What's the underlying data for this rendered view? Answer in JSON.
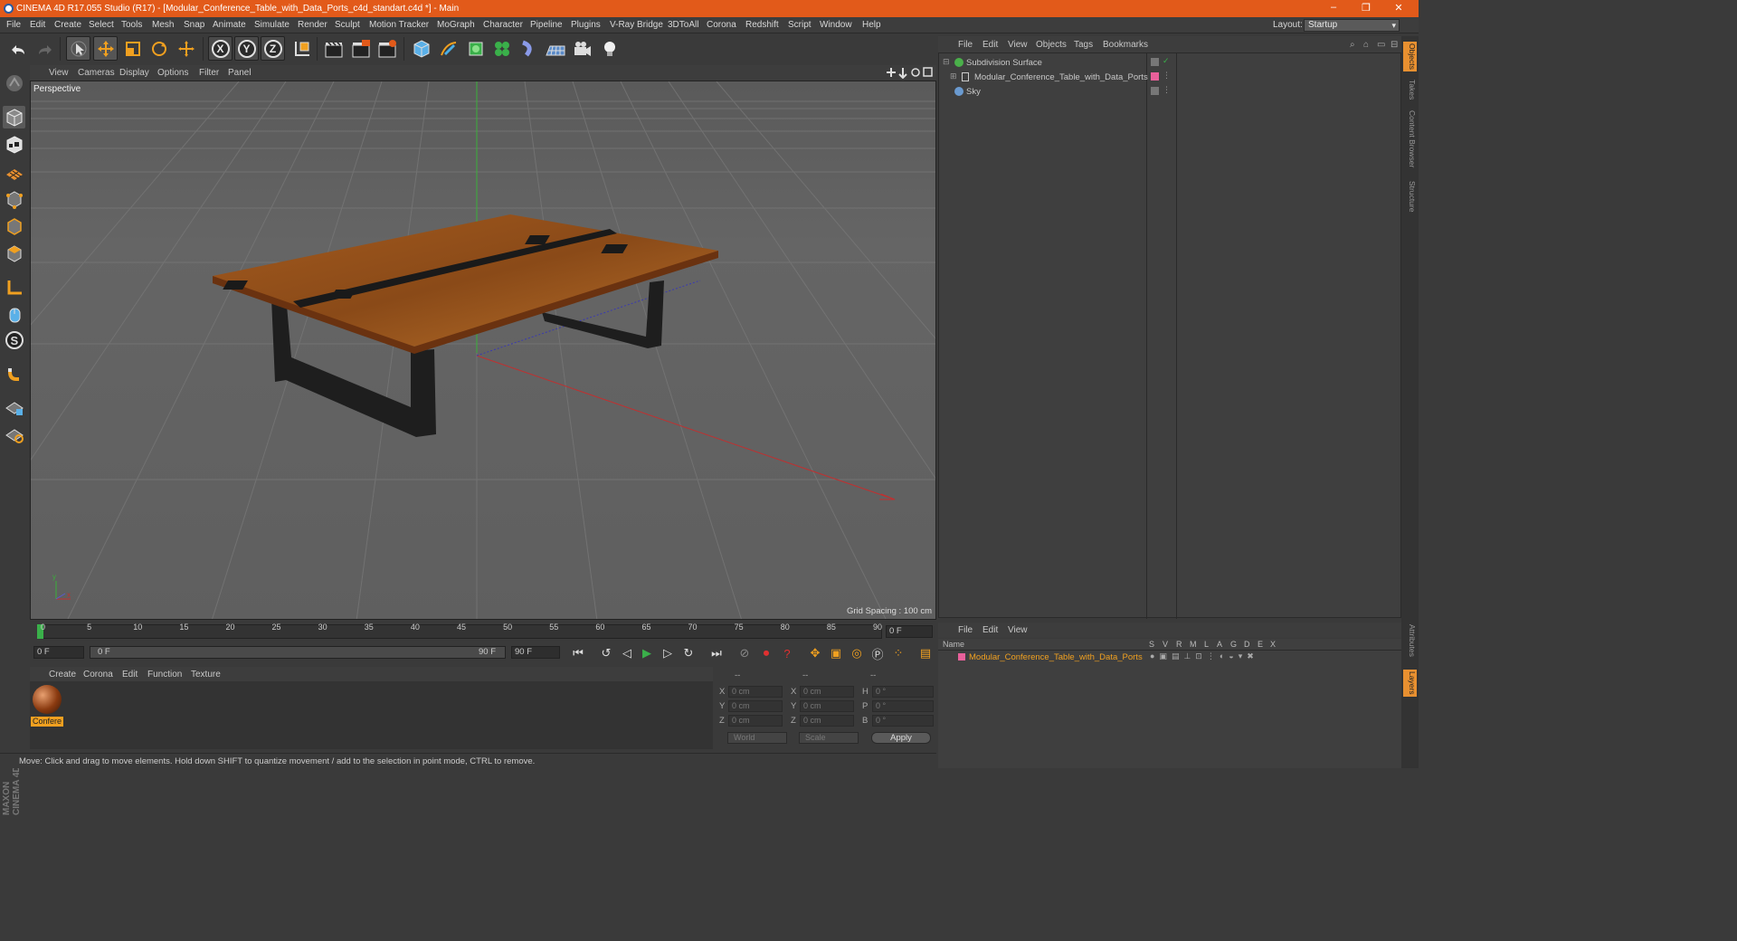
{
  "window": {
    "title": "CINEMA 4D R17.055 Studio (R17) - [Modular_Conference_Table_with_Data_Ports_c4d_standart.c4d *] - Main",
    "minimize": "–",
    "maximize": "❐",
    "close": "✕"
  },
  "menubar": {
    "items": [
      "File",
      "Edit",
      "Create",
      "Select",
      "Tools",
      "Mesh",
      "Snap",
      "Animate",
      "Simulate",
      "Render",
      "Sculpt",
      "Motion Tracker",
      "MoGraph",
      "Character",
      "Pipeline",
      "Plugins",
      "V-Ray Bridge",
      "3DToAll",
      "Corona",
      "Redshift",
      "Script",
      "Window",
      "Help"
    ],
    "layout_label": "Layout:",
    "layout_value": "Startup"
  },
  "toolbar": {
    "axis_x": "X",
    "axis_y": "Y",
    "axis_z": "Z"
  },
  "viewport": {
    "menu": [
      "View",
      "Cameras",
      "Display",
      "Options",
      "Filter",
      "Panel"
    ],
    "label": "Perspective",
    "grid_spacing": "Grid Spacing : 100 cm",
    "axis_y": "y",
    "axis_x": "x"
  },
  "timeline": {
    "ticks": [
      "0",
      "5",
      "10",
      "15",
      "20",
      "25",
      "30",
      "35",
      "40",
      "45",
      "50",
      "55",
      "60",
      "65",
      "70",
      "75",
      "80",
      "85",
      "90"
    ],
    "current_frame": "0 F",
    "start_field": "0 F",
    "range_start": "0 F",
    "range_end": "90 F",
    "end_field": "90 F"
  },
  "material_manager": {
    "menu": [
      "Create",
      "Corona",
      "Edit",
      "Function",
      "Texture"
    ],
    "material_name": "Confere"
  },
  "coordinates": {
    "header": [
      "--",
      "--",
      "--"
    ],
    "rows": [
      {
        "l1": "X",
        "v1": "0 cm",
        "l2": "X",
        "v2": "0 cm",
        "l3": "H",
        "v3": "0 °"
      },
      {
        "l1": "Y",
        "v1": "0 cm",
        "l2": "Y",
        "v2": "0 cm",
        "l3": "P",
        "v3": "0 °"
      },
      {
        "l1": "Z",
        "v1": "0 cm",
        "l2": "Z",
        "v2": "0 cm",
        "l3": "B",
        "v3": "0 °"
      }
    ],
    "mode": "World",
    "transform": "Scale",
    "apply": "Apply"
  },
  "status": {
    "text": "Move: Click and drag to move elements. Hold down SHIFT to quantize movement / add to the selection in point mode, CTRL to remove."
  },
  "object_manager": {
    "menu": [
      "File",
      "Edit",
      "View",
      "Objects",
      "Tags",
      "Bookmarks"
    ],
    "objects": [
      {
        "name": "Subdivision Surface",
        "icon_color": "#4ab04a"
      },
      {
        "name": "Modular_Conference_Table_with_Data_Ports",
        "icon_color": "#cccccc"
      },
      {
        "name": "Sky",
        "icon_color": "#6a9ad0"
      }
    ]
  },
  "layer_manager": {
    "menu": [
      "File",
      "Edit",
      "View"
    ],
    "columns": [
      "Name",
      "S",
      "V",
      "R",
      "M",
      "L",
      "A",
      "G",
      "D",
      "E",
      "X"
    ],
    "layer_name": "Modular_Conference_Table_with_Data_Ports",
    "layer_color": "#e8609a"
  },
  "right_tabs": [
    "Objects",
    "Takes",
    "Content Browser",
    "Structure",
    "Attributes",
    "Layers"
  ],
  "branding": "MAXON CINEMA 4D"
}
